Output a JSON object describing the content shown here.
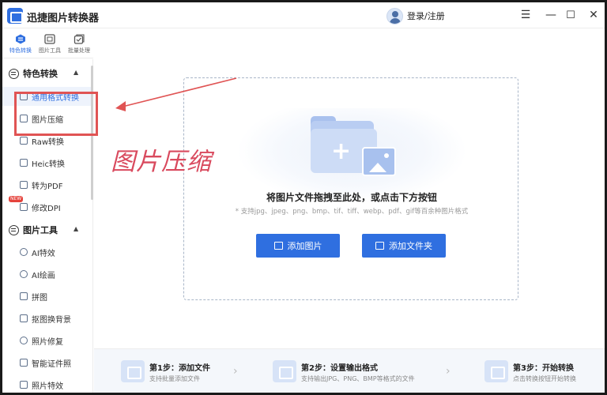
{
  "app": {
    "title": "迅捷图片转换器",
    "login": "登录/注册"
  },
  "window_controls": {
    "menu": "☰",
    "minimize": "—",
    "maximize": "☐",
    "close": "✕"
  },
  "tabs": [
    {
      "label": "特色转换",
      "icon": "special-convert-icon",
      "active": true
    },
    {
      "label": "图片工具",
      "icon": "image-tools-icon",
      "active": false
    },
    {
      "label": "批量处理",
      "icon": "batch-icon",
      "active": false
    }
  ],
  "sidebar": {
    "section1": {
      "label": "特色转换",
      "caret": "▲"
    },
    "items1": [
      {
        "label": "通用格式转换"
      },
      {
        "label": "图片压缩"
      },
      {
        "label": "Raw转换"
      },
      {
        "label": "Heic转换"
      },
      {
        "label": "转为PDF"
      },
      {
        "label": "修改DPI",
        "badge": "NEW"
      }
    ],
    "section2": {
      "label": "图片工具",
      "caret": "▲"
    },
    "items2": [
      {
        "label": "AI特效"
      },
      {
        "label": "AI绘画"
      },
      {
        "label": "拼图"
      },
      {
        "label": "抠图换背景"
      },
      {
        "label": "照片修复"
      },
      {
        "label": "智能证件照"
      },
      {
        "label": "照片特效"
      }
    ]
  },
  "annotation": {
    "text": "图片压缩",
    "color": "#d94a5e"
  },
  "dropzone": {
    "title": "将图片文件拖拽至此处，或点击下方按钮",
    "subtitle": "* 支持jpg、jpeg、png、bmp、tif、tiff、webp、pdf、gif等百余种图片格式",
    "add_image": "添加图片",
    "add_folder": "添加文件夹"
  },
  "steps": [
    {
      "title": "第1步：添加文件",
      "desc": "支持批量添加文件"
    },
    {
      "title": "第2步：设置输出格式",
      "desc": "支持输出JPG、PNG、BMP等格式的文件"
    },
    {
      "title": "第3步：开始转换",
      "desc": "点击转换按钮开始转换"
    }
  ],
  "colors": {
    "accent": "#2f6fe0",
    "annotation": "#e05454"
  }
}
